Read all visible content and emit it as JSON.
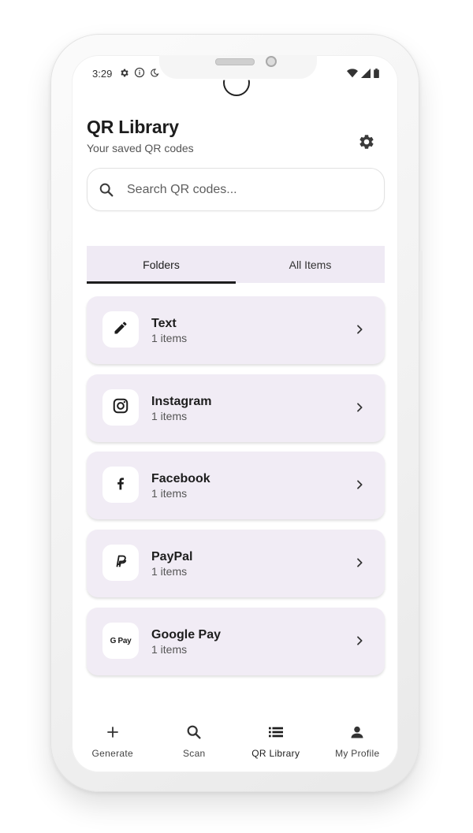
{
  "status_bar": {
    "time": "3:29"
  },
  "header": {
    "title": "QR Library",
    "subtitle": "Your saved QR codes"
  },
  "search": {
    "placeholder": "Search QR codes..."
  },
  "tabs": [
    {
      "label": "Folders",
      "active": true
    },
    {
      "label": "All Items",
      "active": false
    }
  ],
  "folders": [
    {
      "name": "Text",
      "count": "1 items",
      "icon": "pencil-icon"
    },
    {
      "name": "Instagram",
      "count": "1 items",
      "icon": "instagram-icon"
    },
    {
      "name": "Facebook",
      "count": "1 items",
      "icon": "facebook-icon"
    },
    {
      "name": "PayPal",
      "count": "1 items",
      "icon": "paypal-icon"
    },
    {
      "name": "Google Pay",
      "count": "1 items",
      "icon": "google-pay-icon",
      "icon_text": "G Pay"
    }
  ],
  "bottom_nav": [
    {
      "label": "Generate",
      "icon": "plus-icon"
    },
    {
      "label": "Scan",
      "icon": "search-icon"
    },
    {
      "label": "QR Library",
      "icon": "list-icon",
      "active": true
    },
    {
      "label": "My Profile",
      "icon": "person-icon"
    }
  ],
  "colors": {
    "card_background": "#f1ecf5",
    "tab_background": "#efeaf4",
    "text_primary": "#1d1d1d",
    "text_secondary": "#555555"
  }
}
